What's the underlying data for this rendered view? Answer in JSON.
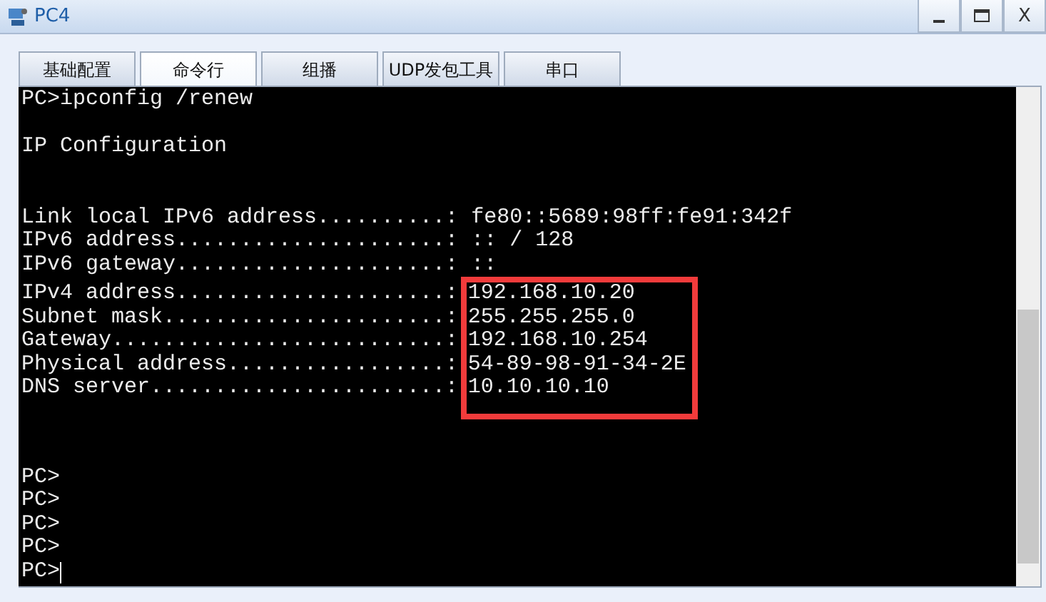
{
  "window": {
    "title": "PC4",
    "close_label": "X"
  },
  "tabs": [
    {
      "label": "基础配置",
      "selected": false
    },
    {
      "label": "命令行",
      "selected": true
    },
    {
      "label": "组播",
      "selected": false
    },
    {
      "label": "UDP发包工具",
      "selected": false
    },
    {
      "label": "串口",
      "selected": false
    }
  ],
  "terminal": {
    "lines": [
      {
        "kind": "text",
        "text": "PC>ipconfig /renew"
      },
      {
        "kind": "blank"
      },
      {
        "kind": "text",
        "text": "IP Configuration"
      },
      {
        "kind": "blank"
      },
      {
        "kind": "blank"
      },
      {
        "kind": "field",
        "label": "Link local IPv6 address..........:",
        "value": "fe80::5689:98ff:fe91:342f",
        "highlighted": false
      },
      {
        "kind": "field",
        "label": "IPv6 address.....................:",
        "value": ":: / 128",
        "highlighted": false
      },
      {
        "kind": "field",
        "label": "IPv6 gateway.....................:",
        "value": "::",
        "highlighted": false
      },
      {
        "kind": "field",
        "label": "IPv4 address.....................:",
        "value": "192.168.10.20",
        "highlighted": true
      },
      {
        "kind": "field",
        "label": "Subnet mask......................:",
        "value": "255.255.255.0",
        "highlighted": true
      },
      {
        "kind": "field",
        "label": "Gateway..........................:",
        "value": "192.168.10.254",
        "highlighted": true
      },
      {
        "kind": "field",
        "label": "Physical address.................:",
        "value": "54-89-98-91-34-2E",
        "highlighted": true
      },
      {
        "kind": "field",
        "label": "DNS server.......................:",
        "value": "10.10.10.10",
        "highlighted": true
      },
      {
        "kind": "blank"
      },
      {
        "kind": "blank"
      },
      {
        "kind": "text",
        "text": "PC>"
      },
      {
        "kind": "text",
        "text": "PC>"
      },
      {
        "kind": "text",
        "text": "PC>"
      },
      {
        "kind": "text",
        "text": "PC>"
      },
      {
        "kind": "prompt",
        "text": "PC>"
      }
    ]
  }
}
